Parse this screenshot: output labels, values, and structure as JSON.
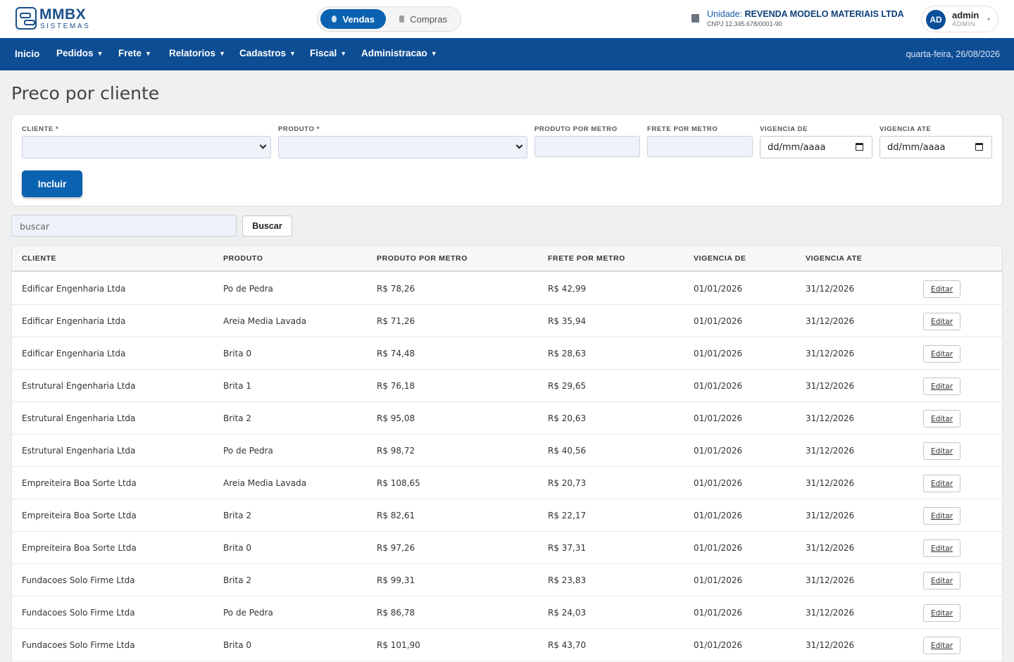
{
  "header": {
    "logo_name": "MMBX",
    "logo_sub": "SISTEMAS",
    "modes": [
      {
        "label": "Vendas",
        "active": true
      },
      {
        "label": "Compras",
        "active": false
      }
    ],
    "unit_label": "Unidade:",
    "unit_name": "REVENDA MODELO MATERIAIS LTDA",
    "unit_cnpj": "CNPJ 12.345.678/0001-90",
    "user_initials": "AD",
    "user_name": "admin",
    "user_role": "ADMIN"
  },
  "nav": {
    "items": [
      {
        "label": "Inicio",
        "dropdown": false
      },
      {
        "label": "Pedidos",
        "dropdown": true
      },
      {
        "label": "Frete",
        "dropdown": true
      },
      {
        "label": "Relatorios",
        "dropdown": true
      },
      {
        "label": "Cadastros",
        "dropdown": true
      },
      {
        "label": "Fiscal",
        "dropdown": true
      },
      {
        "label": "Administracao",
        "dropdown": true
      }
    ],
    "date": "quarta-feira, 26/08/2026"
  },
  "page": {
    "title": "Preco por cliente"
  },
  "form": {
    "cliente_label": "CLIENTE *",
    "produto_label": "PRODUTO *",
    "produto_metro_label": "PRODUTO POR METRO",
    "frete_metro_label": "FRETE POR METRO",
    "vigencia_de_label": "VIGENCIA DE",
    "vigencia_ate_label": "VIGENCIA ATE",
    "date_placeholder": "dd/mm/aaaa",
    "submit_label": "Incluir"
  },
  "search": {
    "placeholder": "buscar",
    "button_label": "Buscar"
  },
  "table": {
    "columns": [
      "CLIENTE",
      "PRODUTO",
      "PRODUTO POR METRO",
      "FRETE POR METRO",
      "VIGENCIA DE",
      "VIGENCIA ATE"
    ],
    "action_label": "Editar",
    "rows": [
      {
        "cliente": "Edificar Engenharia Ltda",
        "produto": "Po de Pedra",
        "produto_metro": "R$ 78,26",
        "frete_metro": "R$ 42,99",
        "de": "01/01/2026",
        "ate": "31/12/2026"
      },
      {
        "cliente": "Edificar Engenharia Ltda",
        "produto": "Areia Media Lavada",
        "produto_metro": "R$ 71,26",
        "frete_metro": "R$ 35,94",
        "de": "01/01/2026",
        "ate": "31/12/2026"
      },
      {
        "cliente": "Edificar Engenharia Ltda",
        "produto": "Brita 0",
        "produto_metro": "R$ 74,48",
        "frete_metro": "R$ 28,63",
        "de": "01/01/2026",
        "ate": "31/12/2026"
      },
      {
        "cliente": "Estrutural Engenharia Ltda",
        "produto": "Brita 1",
        "produto_metro": "R$ 76,18",
        "frete_metro": "R$ 29,65",
        "de": "01/01/2026",
        "ate": "31/12/2026"
      },
      {
        "cliente": "Estrutural Engenharia Ltda",
        "produto": "Brita 2",
        "produto_metro": "R$ 95,08",
        "frete_metro": "R$ 20,63",
        "de": "01/01/2026",
        "ate": "31/12/2026"
      },
      {
        "cliente": "Estrutural Engenharia Ltda",
        "produto": "Po de Pedra",
        "produto_metro": "R$ 98,72",
        "frete_metro": "R$ 40,56",
        "de": "01/01/2026",
        "ate": "31/12/2026"
      },
      {
        "cliente": "Empreiteira Boa Sorte Ltda",
        "produto": "Areia Media Lavada",
        "produto_metro": "R$ 108,65",
        "frete_metro": "R$ 20,73",
        "de": "01/01/2026",
        "ate": "31/12/2026"
      },
      {
        "cliente": "Empreiteira Boa Sorte Ltda",
        "produto": "Brita 2",
        "produto_metro": "R$ 82,61",
        "frete_metro": "R$ 22,17",
        "de": "01/01/2026",
        "ate": "31/12/2026"
      },
      {
        "cliente": "Empreiteira Boa Sorte Ltda",
        "produto": "Brita 0",
        "produto_metro": "R$ 97,26",
        "frete_metro": "R$ 37,31",
        "de": "01/01/2026",
        "ate": "31/12/2026"
      },
      {
        "cliente": "Fundacoes Solo Firme Ltda",
        "produto": "Brita 2",
        "produto_metro": "R$ 99,31",
        "frete_metro": "R$ 23,83",
        "de": "01/01/2026",
        "ate": "31/12/2026"
      },
      {
        "cliente": "Fundacoes Solo Firme Ltda",
        "produto": "Po de Pedra",
        "produto_metro": "R$ 86,78",
        "frete_metro": "R$ 24,03",
        "de": "01/01/2026",
        "ate": "31/12/2026"
      },
      {
        "cliente": "Fundacoes Solo Firme Ltda",
        "produto": "Brita 0",
        "produto_metro": "R$ 101,90",
        "frete_metro": "R$ 43,70",
        "de": "01/01/2026",
        "ate": "31/12/2026"
      }
    ]
  },
  "colors": {
    "primary": "#0b62b0",
    "nav_bg": "#0d4d94",
    "page_bg": "#f0f0f0"
  }
}
